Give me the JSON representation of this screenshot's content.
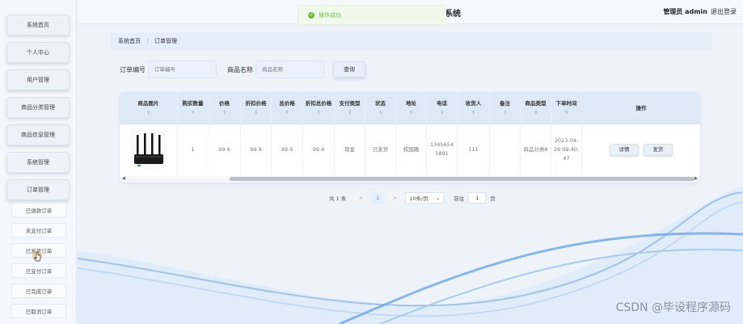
{
  "header": {
    "system_title": "系统",
    "admin_label": "管理员 admin",
    "logout_label": "退出登录",
    "toast": "操作成功",
    "toast_icon": "check-circle-icon"
  },
  "sidebar": {
    "items": [
      {
        "label": "系统首页"
      },
      {
        "label": "个人中心"
      },
      {
        "label": "用户管理"
      },
      {
        "label": "商品分类管理"
      },
      {
        "label": "商品信息管理"
      },
      {
        "label": "系统管理"
      },
      {
        "label": "订单管理"
      }
    ],
    "subitems": [
      {
        "label": "已退款订单"
      },
      {
        "label": "未支付订单"
      },
      {
        "label": "已发货订单"
      },
      {
        "label": "已支付订单"
      },
      {
        "label": "已完成订单"
      },
      {
        "label": "已取消订单"
      }
    ]
  },
  "breadcrumb": {
    "home": "系统首页",
    "separator": "⋮",
    "current": "订单管理"
  },
  "search": {
    "order_no_label": "订单编号",
    "order_no_placeholder": "订单编号",
    "order_no_value": "",
    "goods_name_label": "商品名称",
    "goods_name_placeholder": "商品名称",
    "goods_name_value": "",
    "query_button": "查询"
  },
  "table": {
    "sort_icon": "⇕",
    "columns": [
      {
        "label": "商品图片",
        "sortable": true
      },
      {
        "label": "购买数量",
        "sortable": true
      },
      {
        "label": "价格",
        "sortable": true
      },
      {
        "label": "折扣价格",
        "sortable": true
      },
      {
        "label": "总价格",
        "sortable": true
      },
      {
        "label": "折扣总价格",
        "sortable": true
      },
      {
        "label": "支付类型",
        "sortable": true
      },
      {
        "label": "状态",
        "sortable": true
      },
      {
        "label": "地址",
        "sortable": true
      },
      {
        "label": "电话",
        "sortable": true
      },
      {
        "label": "收货人",
        "sortable": true
      },
      {
        "label": "备注",
        "sortable": true
      },
      {
        "label": "商品类型",
        "sortable": true
      },
      {
        "label": "下单时间",
        "sortable": true
      },
      {
        "label": "操作",
        "sortable": false
      }
    ],
    "rows": [
      {
        "quantity": "1",
        "price": "99.9",
        "discount_price": "99.9",
        "total_price": "99.9",
        "discount_total": "99.9",
        "pay_type": "现金",
        "status": "已发货",
        "address": "校园路",
        "phone": "13456545891",
        "receiver": "111",
        "remark": "",
        "goods_type": "商品分类8",
        "order_time": "2023-04-29 09:40:47",
        "actions": {
          "detail": "详情",
          "ship": "发货"
        }
      }
    ]
  },
  "pagination": {
    "total_text": "共 1 条",
    "prev": "<",
    "current_page": "1",
    "next": ">",
    "page_size": "10条/页",
    "goto_label": "前往",
    "goto_value": "1",
    "page_suffix": "页"
  },
  "watermark": "CSDN @毕设程序源码",
  "colors": {
    "accent": "#4a8af0",
    "success": "#67c23a",
    "header_bg": "#dde9f7"
  }
}
